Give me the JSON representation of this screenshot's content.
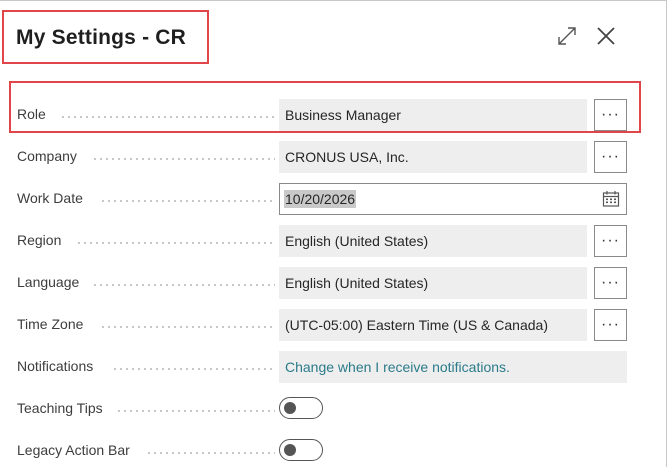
{
  "dialog": {
    "title": "My Settings - CR",
    "expand_icon": "expand-diagonal-icon",
    "close_icon": "close-x-icon"
  },
  "fields": {
    "role": {
      "label": "Role",
      "value": "Business Manager"
    },
    "company": {
      "label": "Company",
      "value": "CRONUS USA, Inc."
    },
    "work_date": {
      "label": "Work Date",
      "value": "10/20/2026"
    },
    "region": {
      "label": "Region",
      "value": "English (United States)"
    },
    "language": {
      "label": "Language",
      "value": "English (United States)"
    },
    "time_zone": {
      "label": "Time Zone",
      "value": "(UTC-05:00) Eastern Time (US & Canada)"
    },
    "notifications": {
      "label": "Notifications",
      "value": "Change when I receive notifications."
    },
    "teaching_tips": {
      "label": "Teaching Tips",
      "enabled": false
    },
    "legacy_action_bar": {
      "label": "Legacy Action Bar",
      "enabled": false
    }
  },
  "more_button_label": "···",
  "colors": {
    "highlight": "#e0454a",
    "link": "#2b7b8a",
    "field_bg": "#eeeeee"
  }
}
